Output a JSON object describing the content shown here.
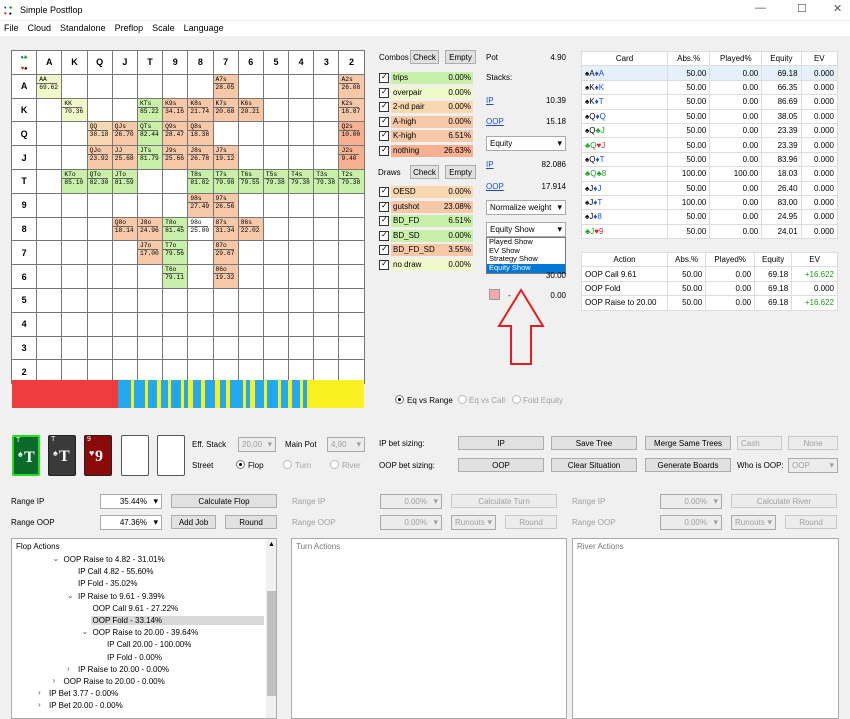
{
  "window": {
    "title": "Simple Postflop"
  },
  "menu": [
    "File",
    "Cloud",
    "Standalone",
    "Preflop",
    "Scale",
    "Language"
  ],
  "ranks": [
    "A",
    "K",
    "Q",
    "J",
    "T",
    "9",
    "8",
    "7",
    "6",
    "5",
    "4",
    "3",
    "2"
  ],
  "grid_cells": [
    {
      "r": 0,
      "c": 0,
      "h": "AA",
      "v": "69.62",
      "col": "#eef8c8"
    },
    {
      "r": 0,
      "c": 7,
      "h": "A7s",
      "v": "28.05",
      "col": "#f7c8a8"
    },
    {
      "r": 0,
      "c": 12,
      "h": "A2s",
      "v": "26.08",
      "col": "#f7c8a8"
    },
    {
      "r": 1,
      "c": 1,
      "h": "KK",
      "v": "70.36",
      "col": "#eef8c8"
    },
    {
      "r": 1,
      "c": 4,
      "h": "KTs",
      "v": "85.22",
      "col": "#c8f0a8"
    },
    {
      "r": 1,
      "c": 5,
      "h": "K9s",
      "v": "34.16",
      "col": "#f7c8a8"
    },
    {
      "r": 1,
      "c": 6,
      "h": "K8s",
      "v": "21.74",
      "col": "#f7c8a8"
    },
    {
      "r": 1,
      "c": 7,
      "h": "K7s",
      "v": "20.68",
      "col": "#f7c8a8"
    },
    {
      "r": 1,
      "c": 8,
      "h": "K6s",
      "v": "20.21",
      "col": "#f7c8a8"
    },
    {
      "r": 1,
      "c": 12,
      "h": "K2s",
      "v": "18.87",
      "col": "#f7c8a8"
    },
    {
      "r": 2,
      "c": 2,
      "h": "QQ",
      "v": "38.18",
      "col": "#f7d8b0"
    },
    {
      "r": 2,
      "c": 3,
      "h": "QJs",
      "v": "26.70",
      "col": "#f7c8a8"
    },
    {
      "r": 2,
      "c": 4,
      "h": "QTs",
      "v": "82.44",
      "col": "#c8f0a8"
    },
    {
      "r": 2,
      "c": 5,
      "h": "Q9s",
      "v": "28.47",
      "col": "#f7c8a8"
    },
    {
      "r": 2,
      "c": 6,
      "h": "Q8s",
      "v": "18.38",
      "col": "#f7c8a8"
    },
    {
      "r": 2,
      "c": 12,
      "h": "Q2s",
      "v": "10.00",
      "col": "#f7b090"
    },
    {
      "r": 3,
      "c": 2,
      "h": "QJo",
      "v": "23.92",
      "col": "#f7c8a8"
    },
    {
      "r": 3,
      "c": 3,
      "h": "JJ",
      "v": "25.68",
      "col": "#f7c8a8"
    },
    {
      "r": 3,
      "c": 4,
      "h": "JTs",
      "v": "81.79",
      "col": "#c8f0a8"
    },
    {
      "r": 3,
      "c": 5,
      "h": "J9s",
      "v": "25.66",
      "col": "#f7c8a8"
    },
    {
      "r": 3,
      "c": 6,
      "h": "J8s",
      "v": "26.78",
      "col": "#f7c8a8"
    },
    {
      "r": 3,
      "c": 7,
      "h": "J7s",
      "v": "19.12",
      "col": "#f7c8a8"
    },
    {
      "r": 3,
      "c": 12,
      "h": "J2s",
      "v": "9.40",
      "col": "#f7b090"
    },
    {
      "r": 4,
      "c": 1,
      "h": "KTo",
      "v": "85.10",
      "col": "#c8f0a8"
    },
    {
      "r": 4,
      "c": 2,
      "h": "QTo",
      "v": "82.30",
      "col": "#c8f0a8"
    },
    {
      "r": 4,
      "c": 3,
      "h": "JTo",
      "v": "81.59",
      "col": "#c8f0a8"
    },
    {
      "r": 4,
      "c": 6,
      "h": "T8s",
      "v": "81.82",
      "col": "#c8f0a8"
    },
    {
      "r": 4,
      "c": 7,
      "h": "T7s",
      "v": "79.98",
      "col": "#c8f0a8"
    },
    {
      "r": 4,
      "c": 8,
      "h": "T6s",
      "v": "79.55",
      "col": "#c8f0a8"
    },
    {
      "r": 4,
      "c": 9,
      "h": "T5s",
      "v": "79.38",
      "col": "#c8f0a8"
    },
    {
      "r": 4,
      "c": 10,
      "h": "T4s",
      "v": "79.38",
      "col": "#c8f0a8"
    },
    {
      "r": 4,
      "c": 11,
      "h": "T3s",
      "v": "79.38",
      "col": "#c8f0a8"
    },
    {
      "r": 4,
      "c": 12,
      "h": "T2s",
      "v": "79.38",
      "col": "#c8f0a8"
    },
    {
      "r": 5,
      "c": 6,
      "h": "98s",
      "v": "27.49",
      "col": "#f7c8a8"
    },
    {
      "r": 5,
      "c": 7,
      "h": "97s",
      "v": "26.56",
      "col": "#f7c8a8"
    },
    {
      "r": 6,
      "c": 3,
      "h": "Q8o",
      "v": "18.14",
      "col": "#f7c8a8"
    },
    {
      "r": 6,
      "c": 4,
      "h": "J8o",
      "v": "24.96",
      "col": "#f7c8a8"
    },
    {
      "r": 6,
      "c": 5,
      "h": "T8o",
      "v": "81.45",
      "col": "#c8f0a8"
    },
    {
      "r": 6,
      "c": 6,
      "h": "98o",
      "v": "25.00",
      "col": "#ffffff"
    },
    {
      "r": 6,
      "c": 7,
      "h": "87s",
      "v": "31.34",
      "col": "#f7c8a8"
    },
    {
      "r": 6,
      "c": 8,
      "h": "86s",
      "v": "22.02",
      "col": "#f7c8a8"
    },
    {
      "r": 7,
      "c": 4,
      "h": "J7o",
      "v": "17.00",
      "col": "#f7c8a8"
    },
    {
      "r": 7,
      "c": 5,
      "h": "T7o",
      "v": "79.56",
      "col": "#c8f0a8"
    },
    {
      "r": 7,
      "c": 7,
      "h": "87o",
      "v": "29.67",
      "col": "#f7c8a8"
    },
    {
      "r": 8,
      "c": 5,
      "h": "T6o",
      "v": "79.11",
      "col": "#c8f0a8"
    },
    {
      "r": 8,
      "c": 7,
      "h": "86o",
      "v": "19.32",
      "col": "#f7c8a8"
    }
  ],
  "strip": [
    {
      "c": "#f03c3c",
      "w": 98
    },
    {
      "c": "#24a8f0",
      "w": 12
    },
    {
      "c": "#f8f020",
      "w": 3
    },
    {
      "c": "#24a8f0",
      "w": 10
    },
    {
      "c": "#f8f020",
      "w": 3
    },
    {
      "c": "#24a8f0",
      "w": 8
    },
    {
      "c": "#f8f020",
      "w": 4
    },
    {
      "c": "#24a8f0",
      "w": 6
    },
    {
      "c": "#f8f020",
      "w": 3
    },
    {
      "c": "#24a8f0",
      "w": 9
    },
    {
      "c": "#f8f020",
      "w": 3
    },
    {
      "c": "#24a8f0",
      "w": 4
    },
    {
      "c": "#f8f020",
      "w": 4
    },
    {
      "c": "#24a8f0",
      "w": 8
    },
    {
      "c": "#f8f020",
      "w": 3
    },
    {
      "c": "#24a8f0",
      "w": 10
    },
    {
      "c": "#f8f020",
      "w": 4
    },
    {
      "c": "#24a8f0",
      "w": 6
    },
    {
      "c": "#f8f020",
      "w": 3
    },
    {
      "c": "#24a8f0",
      "w": 12
    },
    {
      "c": "#f8f020",
      "w": 3
    },
    {
      "c": "#24a8f0",
      "w": 4
    },
    {
      "c": "#f8f020",
      "w": 5
    },
    {
      "c": "#24a8f0",
      "w": 8
    },
    {
      "c": "#f8f020",
      "w": 3
    },
    {
      "c": "#24a8f0",
      "w": 10
    },
    {
      "c": "#f8f020",
      "w": 3
    },
    {
      "c": "#24a8f0",
      "w": 6
    },
    {
      "c": "#f8f020",
      "w": 4
    },
    {
      "c": "#24a8f0",
      "w": 7
    },
    {
      "c": "#f8f020",
      "w": 3
    },
    {
      "c": "#24a8f0",
      "w": 4
    },
    {
      "c": "#f8f020",
      "w": 52
    }
  ],
  "combos": {
    "title": "Combos",
    "check": "Check",
    "empty": "Empty",
    "items": [
      {
        "label": "trips",
        "val": "0.00%",
        "col": "#c8f0a8"
      },
      {
        "label": "overpair",
        "val": "0.00%",
        "col": "#eef8c8"
      },
      {
        "label": "2-nd pair",
        "val": "0.00%",
        "col": "#f7d8b0"
      },
      {
        "label": "A-high",
        "val": "0.00%",
        "col": "#f7c8a8"
      },
      {
        "label": "K-high",
        "val": "6.51%",
        "col": "#f7c8a8"
      },
      {
        "label": "nothing",
        "val": "26.63%",
        "col": "#f7b090"
      }
    ]
  },
  "draws": {
    "title": "Draws",
    "check": "Check",
    "empty": "Empty",
    "items": [
      {
        "label": "OESD",
        "val": "0.00%",
        "col": "#f7d8b0"
      },
      {
        "label": "gutshot",
        "val": "23.08%",
        "col": "#f7c8a8"
      },
      {
        "label": "BD_FD",
        "val": "6.51%",
        "col": "#c8f0a8"
      },
      {
        "label": "BD_SD",
        "val": "0.00%",
        "col": "#c8f0a8"
      },
      {
        "label": "BD_FD_SD",
        "val": "3.55%",
        "col": "#f7c8a8"
      },
      {
        "label": "no draw",
        "val": "0.00%",
        "col": "#eef8c8"
      }
    ]
  },
  "pot": {
    "label": "Pot",
    "value": "4.90",
    "stacks": "Stacks:",
    "ip": "IP",
    "ip_stack": "10.39",
    "oop": "OOP",
    "oop_stack": "15.18",
    "metric": "Equity",
    "ip_eq": "82.086",
    "oop_eq": "17.914",
    "normalize": "Normalize weight",
    "show": "Equity Show",
    "show_options": [
      "Played Show",
      "EV Show",
      "Strategy Show",
      "Equity Show"
    ],
    "val2": "30.00",
    "dash": "-",
    "val3": "0.00"
  },
  "card_table": {
    "headers": [
      "Card",
      "Abs.%",
      "Played%",
      "Equity",
      "EV"
    ],
    "rows": [
      {
        "c1": "A",
        "s1": "♠",
        "k1": "#000",
        "c2": "A",
        "s2": "♦",
        "k2": "#1a50e0",
        "abs": "50.00",
        "pl": "0.00",
        "eq": "69.18",
        "ev": "0.000"
      },
      {
        "c1": "K",
        "s1": "♠",
        "k1": "#000",
        "c2": "K",
        "s2": "♦",
        "k2": "#1a50e0",
        "abs": "50.00",
        "pl": "0.00",
        "eq": "66.35",
        "ev": "0.000"
      },
      {
        "c1": "K",
        "s1": "♠",
        "k1": "#000",
        "c2": "T",
        "s2": "♦",
        "k2": "#1a50e0",
        "abs": "50.00",
        "pl": "0.00",
        "eq": "86.69",
        "ev": "0.000"
      },
      {
        "c1": "Q",
        "s1": "♠",
        "k1": "#000",
        "c2": "Q",
        "s2": "♦",
        "k2": "#1a50e0",
        "abs": "50.00",
        "pl": "0.00",
        "eq": "38.05",
        "ev": "0.000"
      },
      {
        "c1": "Q",
        "s1": "♠",
        "k1": "#000",
        "c2": "J",
        "s2": "♣",
        "k2": "#20a020",
        "abs": "50.00",
        "pl": "0.00",
        "eq": "23.39",
        "ev": "0.000"
      },
      {
        "c1": "Q",
        "s1": "♣",
        "k1": "#20a020",
        "c2": "J",
        "s2": "♥",
        "k2": "#e02020",
        "abs": "50.00",
        "pl": "0.00",
        "eq": "23.39",
        "ev": "0.000"
      },
      {
        "c1": "Q",
        "s1": "♠",
        "k1": "#000",
        "c2": "T",
        "s2": "♦",
        "k2": "#1a50e0",
        "abs": "50.00",
        "pl": "0.00",
        "eq": "83.96",
        "ev": "0.000"
      },
      {
        "c1": "Q",
        "s1": "♣",
        "k1": "#20a020",
        "c2": "8",
        "s2": "♣",
        "k2": "#20a020",
        "abs": "100.00",
        "pl": "100.00",
        "eq": "18.03",
        "ev": "0.000"
      },
      {
        "c1": "J",
        "s1": "♠",
        "k1": "#000",
        "c2": "J",
        "s2": "♦",
        "k2": "#1a50e0",
        "abs": "50.00",
        "pl": "0.00",
        "eq": "26.40",
        "ev": "0.000"
      },
      {
        "c1": "J",
        "s1": "♠",
        "k1": "#000",
        "c2": "T",
        "s2": "♦",
        "k2": "#1a50e0",
        "abs": "100.00",
        "pl": "0.00",
        "eq": "83.00",
        "ev": "0.000"
      },
      {
        "c1": "J",
        "s1": "♠",
        "k1": "#000",
        "c2": "8",
        "s2": "♦",
        "k2": "#1a50e0",
        "abs": "50.00",
        "pl": "0.00",
        "eq": "24.95",
        "ev": "0.000"
      },
      {
        "c1": "J",
        "s1": "♣",
        "k1": "#20a020",
        "c2": "9",
        "s2": "♥",
        "k2": "#e02020",
        "abs": "50.00",
        "pl": "0.00",
        "eq": "24.01",
        "ev": "0.000"
      }
    ]
  },
  "action_table": {
    "headers": [
      "Action",
      "Abs.%",
      "Played%",
      "Equity",
      "EV"
    ],
    "rows": [
      {
        "a": "OOP Call 9.61",
        "abs": "50.00",
        "pl": "0.00",
        "eq": "69.18",
        "ev": "+16.622"
      },
      {
        "a": "OOP Fold",
        "abs": "50.00",
        "pl": "0.00",
        "eq": "69.18",
        "ev": "0.000"
      },
      {
        "a": "OOP Raise to 20.00",
        "abs": "50.00",
        "pl": "0.00",
        "eq": "69.18",
        "ev": "+16.622"
      }
    ]
  },
  "eq_radio": {
    "eq_vs_range": "Eq vs Range",
    "eq_vs_call": "Eq vs Call",
    "fold_equity": "Fold Equity"
  },
  "board": [
    {
      "rank": "T",
      "suit": "♠",
      "bg": "#0a6a2a"
    },
    {
      "rank": "T",
      "suit": "♠",
      "bg": "#3a3a3a"
    },
    {
      "rank": "9",
      "suit": "♥",
      "bg": "#8a0a0a"
    }
  ],
  "eff_stack": {
    "label": "Eff. Stack",
    "value": "20,00",
    "main_pot": "Main Pot",
    "main_pot_value": "4,90"
  },
  "street": {
    "label": "Street",
    "flop": "Flop",
    "turn": "Turn",
    "river": "River"
  },
  "sizing": {
    "ip_label": "IP bet sizing:",
    "ip_val": "IP",
    "oop_label": "OOP bet sizing:",
    "oop_val": "OOP",
    "save_tree": "Save Tree",
    "merge": "Merge Same Trees",
    "cash": "Cash",
    "none": "None",
    "clear": "Clear Situation",
    "gen": "Generate Boards",
    "who_oop": "Who is OOP:",
    "who_oop_val": "OOP"
  },
  "ranges": {
    "range_ip": "Range IP",
    "range_oop": "Range OOP",
    "ip_val": "35.44%",
    "oop_val": "47.36%",
    "calc_flop": "Calculate Flop",
    "add_job": "Add Job",
    "round": "Round",
    "zero": "0.00%",
    "calc_turn": "Calculate Turn",
    "calc_river": "Calculate River",
    "runouts": "Runouts"
  },
  "flop_actions": {
    "title": "Flop Actions",
    "nodes": [
      {
        "t": "OOP Raise to 4.82 - 31.01%",
        "d": 3,
        "ex": "open"
      },
      {
        "t": "IP Call 4.82 - 55.60%",
        "d": 4,
        "ex": ""
      },
      {
        "t": "IP Fold - 35.02%",
        "d": 4,
        "ex": ""
      },
      {
        "t": "IP Raise to 9.61 - 9.39%",
        "d": 4,
        "ex": "open"
      },
      {
        "t": "OOP Call 9.61 - 27.22%",
        "d": 5,
        "ex": ""
      },
      {
        "t": "OOP Fold - 33.14%",
        "d": 5,
        "ex": "",
        "sel": true
      },
      {
        "t": "OOP Raise to 20.00 - 39.64%",
        "d": 5,
        "ex": "open"
      },
      {
        "t": "IP Call 20.00 - 100.00%",
        "d": 6,
        "ex": ""
      },
      {
        "t": "IP Fold - 0.00%",
        "d": 6,
        "ex": ""
      },
      {
        "t": "IP Raise to 20.00 - 0.00%",
        "d": 4,
        "ex": "closed"
      },
      {
        "t": "OOP Raise to 20.00 - 0.00%",
        "d": 3,
        "ex": "closed"
      },
      {
        "t": "IP Bet 3.77 - 0.00%",
        "d": 2,
        "ex": "closed"
      },
      {
        "t": "IP Bet 20.00 - 0.00%",
        "d": 2,
        "ex": "closed"
      }
    ]
  },
  "turn_actions": {
    "title": "Turn Actions"
  },
  "river_actions": {
    "title": "River Actions"
  }
}
